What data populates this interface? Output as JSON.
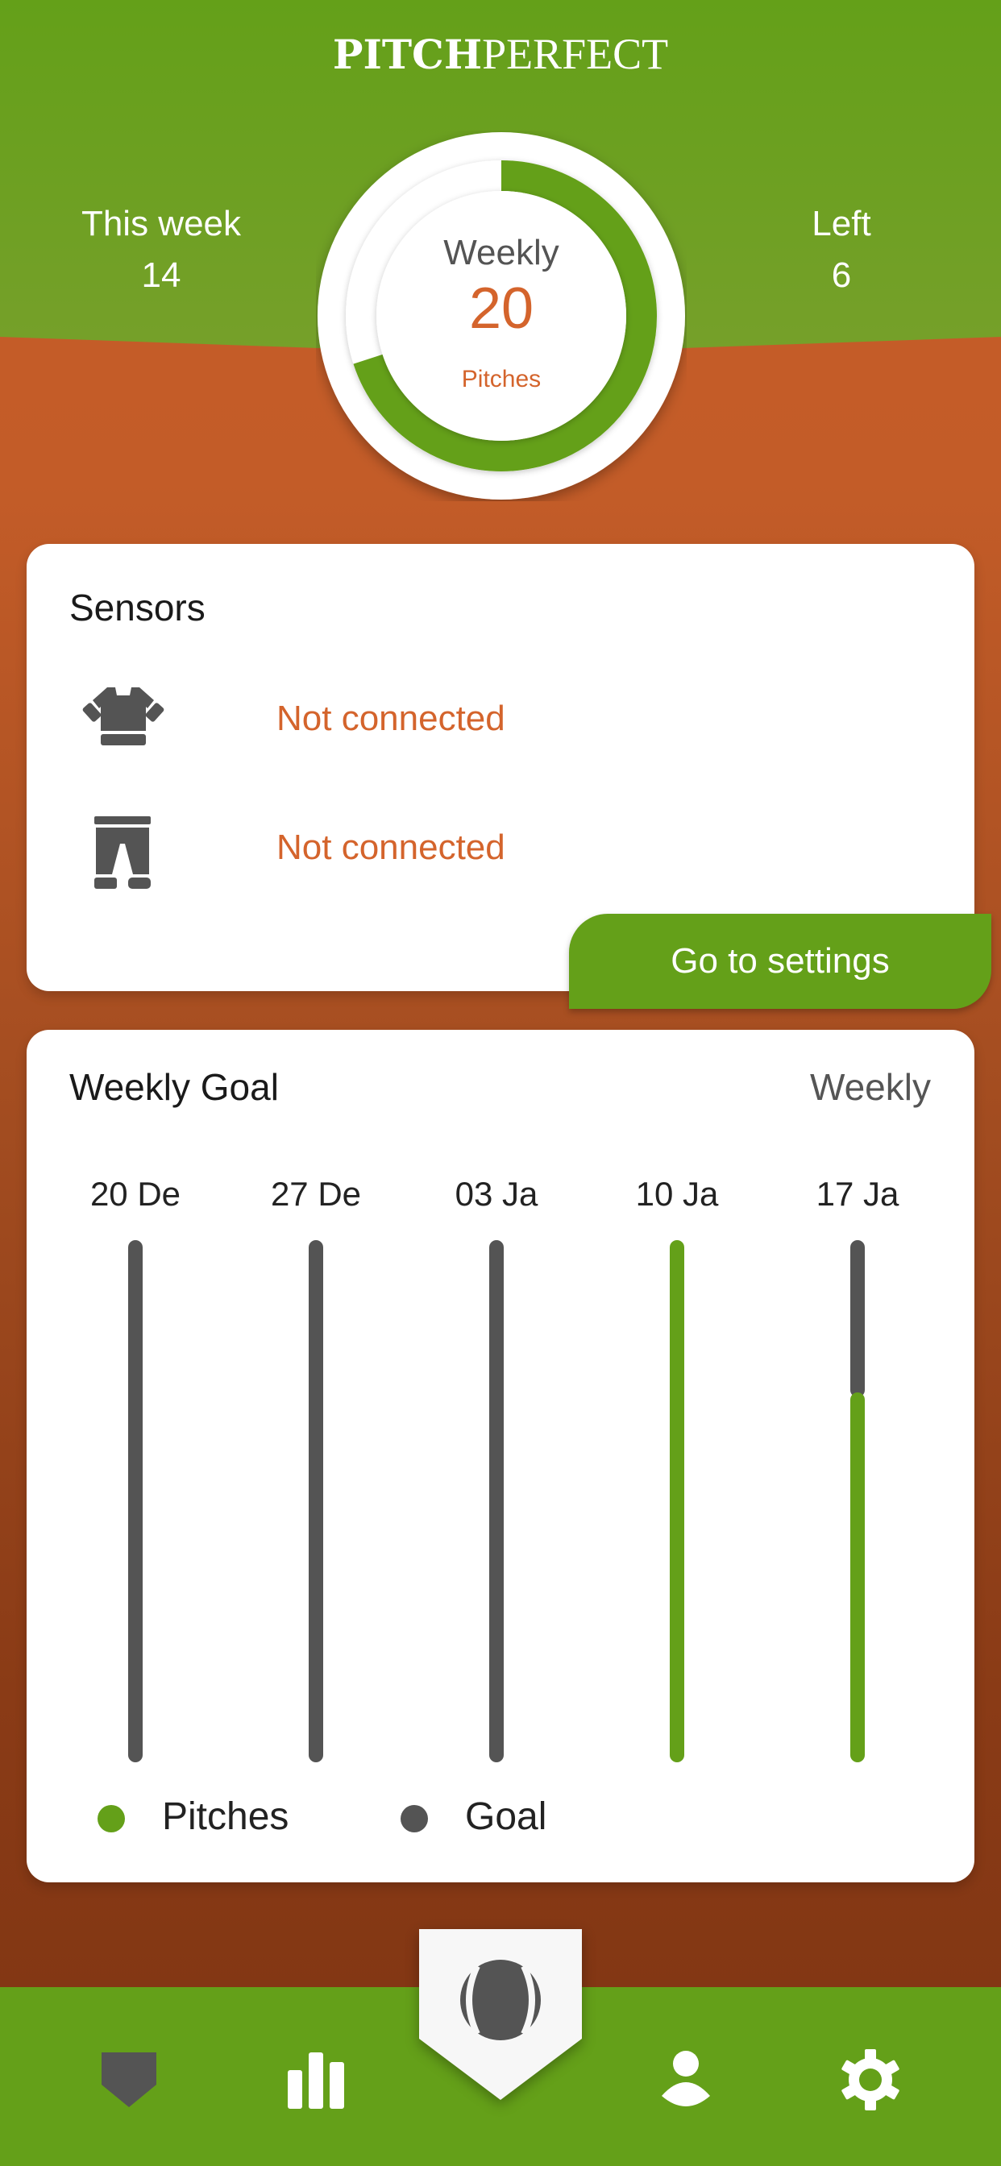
{
  "app": {
    "title_bold": "PITCH",
    "title_light": "PERFECT"
  },
  "colors": {
    "brand_green": "#64a019",
    "accent_orange": "#d4642c",
    "dark_gray": "#545454",
    "track_white": "#ffffff"
  },
  "summary": {
    "this_week_label": "This week",
    "this_week_value": "14",
    "left_label": "Left",
    "left_value": "6"
  },
  "gauge": {
    "title": "Weekly",
    "value": "20",
    "unit": "Pitches",
    "progress_fraction": 0.7
  },
  "sensors": {
    "title": "Sensors",
    "items": [
      {
        "icon": "shirt-icon",
        "status": "Not connected"
      },
      {
        "icon": "pants-icon",
        "status": "Not connected"
      }
    ],
    "settings_button": "Go to settings"
  },
  "weekly_goal": {
    "title": "Weekly Goal",
    "period": "Weekly",
    "legend": [
      {
        "label": "Pitches",
        "color": "#64a019"
      },
      {
        "label": "Goal",
        "color": "#545454"
      }
    ]
  },
  "chart_data": {
    "type": "bar",
    "title": "Weekly Goal",
    "categories": [
      "20 De",
      "27 De",
      "03 Ja",
      "10 Ja",
      "17 Ja"
    ],
    "series": [
      {
        "name": "Pitches",
        "values": [
          0,
          0,
          0,
          20,
          14
        ],
        "color": "#64a019"
      },
      {
        "name": "Goal",
        "values": [
          20,
          20,
          20,
          20,
          20
        ],
        "color": "#545454"
      }
    ],
    "ylim": [
      0,
      20
    ],
    "xlabel": "",
    "ylabel": "",
    "legend_position": "bottom-left",
    "grid": false
  },
  "nav": {
    "items": [
      {
        "name": "home",
        "icon": "home-plate-icon",
        "active": false
      },
      {
        "name": "stats",
        "icon": "bar-chart-icon",
        "active": false
      },
      {
        "name": "pitch",
        "icon": "baseball-icon",
        "active": true
      },
      {
        "name": "profile",
        "icon": "user-icon",
        "active": false
      },
      {
        "name": "settings",
        "icon": "gear-icon",
        "active": false
      }
    ]
  }
}
